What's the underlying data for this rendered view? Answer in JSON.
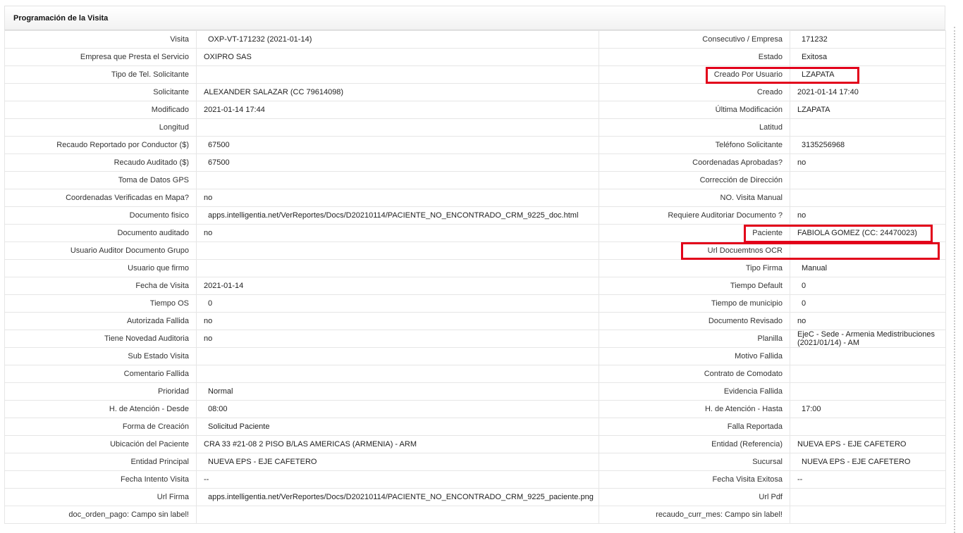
{
  "panel": {
    "title": "Programación de la Visita"
  },
  "rows": [
    {
      "l1": "Visita",
      "v1": "OXP-VT-171232 (2021-01-14)",
      "l2": "Consecutivo / Empresa",
      "v2": "171232",
      "i1": true,
      "i2": true
    },
    {
      "l1": "Empresa que Presta el Servicio",
      "v1": "OXIPRO SAS",
      "l2": "Estado",
      "v2": "Exitosa",
      "i1": false,
      "i2": true
    },
    {
      "l1": "Tipo de Tel. Solicitante",
      "v1": "",
      "l2": "Creado Por Usuario",
      "v2": "LZAPATA",
      "i1": false,
      "i2": true
    },
    {
      "l1": "Solicitante",
      "v1": "ALEXANDER SALAZAR (CC 79614098)",
      "l2": "Creado",
      "v2": "2021-01-14 17:40",
      "i1": false,
      "i2": false
    },
    {
      "l1": "Modificado",
      "v1": "2021-01-14 17:44",
      "l2": "Última Modificación",
      "v2": "LZAPATA",
      "i1": false,
      "i2": false
    },
    {
      "l1": "Longitud",
      "v1": "",
      "l2": "Latitud",
      "v2": "",
      "i1": false,
      "i2": false
    },
    {
      "l1": "Recaudo Reportado por Conductor ($)",
      "v1": "67500",
      "l2": "Teléfono Solicitante",
      "v2": "3135256968",
      "i1": true,
      "i2": true
    },
    {
      "l1": "Recaudo Auditado ($)",
      "v1": "67500",
      "l2": "Coordenadas Aprobadas?",
      "v2": "no",
      "i1": true,
      "i2": false
    },
    {
      "l1": "Toma de Datos GPS",
      "v1": "",
      "l2": "Corrección de Dirección",
      "v2": "",
      "i1": false,
      "i2": false
    },
    {
      "l1": "Coordenadas Verificadas en Mapa?",
      "v1": "no",
      "l2": "NO. Visita Manual",
      "v2": "",
      "i1": false,
      "i2": false
    },
    {
      "l1": "Documento fisico",
      "v1": "apps.intelligentia.net/VerReportes/Docs/D20210114/PACIENTE_NO_ENCONTRADO_CRM_9225_doc.html",
      "l2": "Requiere Auditoriar Documento ?",
      "v2": "no",
      "i1": true,
      "i2": false
    },
    {
      "l1": "Documento auditado",
      "v1": "no",
      "l2": "Paciente",
      "v2": "FABIOLA GOMEZ (CC: 24470023)",
      "i1": false,
      "i2": false
    },
    {
      "l1": "Usuario Auditor Documento Grupo",
      "v1": "",
      "l2": "Url Docuemtnos OCR",
      "v2": "",
      "i1": false,
      "i2": false
    },
    {
      "l1": "Usuario que firmo",
      "v1": "",
      "l2": "Tipo Firma",
      "v2": "Manual",
      "i1": false,
      "i2": true
    },
    {
      "l1": "Fecha de Visita",
      "v1": "2021-01-14",
      "l2": "Tiempo Default",
      "v2": "0",
      "i1": false,
      "i2": true
    },
    {
      "l1": "Tiempo OS",
      "v1": "0",
      "l2": "Tiempo de municipio",
      "v2": "0",
      "i1": true,
      "i2": true
    },
    {
      "l1": "Autorizada Fallida",
      "v1": "no",
      "l2": "Documento Revisado",
      "v2": "no",
      "i1": false,
      "i2": false
    },
    {
      "l1": "Tiene Novedad Auditoria",
      "v1": "no",
      "l2": "Planilla",
      "v2": "EjeC - Sede - Armenia Medistribuciones (2021/01/14) - AM",
      "i1": false,
      "i2": false,
      "w2": true
    },
    {
      "l1": "Sub Estado Visita",
      "v1": "",
      "l2": "Motivo Fallida",
      "v2": "",
      "i1": false,
      "i2": false
    },
    {
      "l1": "Comentario Fallida",
      "v1": "",
      "l2": "Contrato de Comodato",
      "v2": "",
      "i1": false,
      "i2": false
    },
    {
      "l1": "Prioridad",
      "v1": "Normal",
      "l2": "Evidencia Fallida",
      "v2": "",
      "i1": true,
      "i2": false
    },
    {
      "l1": "H. de Atención - Desde",
      "v1": "08:00",
      "l2": "H. de Atención - Hasta",
      "v2": "17:00",
      "i1": true,
      "i2": true
    },
    {
      "l1": "Forma de Creación",
      "v1": "Solicitud Paciente",
      "l2": "Falla Reportada",
      "v2": "",
      "i1": true,
      "i2": false
    },
    {
      "l1": "Ubicación del Paciente",
      "v1": "CRA 33 #21-08 2 PISO B/LAS AMERICAS (ARMENIA) - ARM",
      "l2": "Entidad (Referencia)",
      "v2": "NUEVA EPS - EJE CAFETERO",
      "i1": false,
      "i2": false
    },
    {
      "l1": "Entidad Principal",
      "v1": "NUEVA EPS - EJE CAFETERO",
      "l2": "Sucursal",
      "v2": "NUEVA EPS - EJE CAFETERO",
      "i1": true,
      "i2": true
    },
    {
      "l1": "Fecha Intento Visita",
      "v1": "--",
      "l2": "Fecha Visita Exitosa",
      "v2": "--",
      "i1": false,
      "i2": false
    },
    {
      "l1": "Url Firma",
      "v1": "apps.intelligentia.net/VerReportes/Docs/D20210114/PACIENTE_NO_ENCONTRADO_CRM_9225_paciente.png",
      "l2": "Url Pdf",
      "v2": "",
      "i1": true,
      "i2": false
    },
    {
      "l1": "doc_orden_pago: Campo sin label!",
      "v1": "",
      "l2": "recaudo_curr_mes: Campo sin label!",
      "v2": "",
      "i1": false,
      "i2": false
    }
  ],
  "colors": {
    "highlight": "#e2001a",
    "border": "#e6e6e6"
  }
}
